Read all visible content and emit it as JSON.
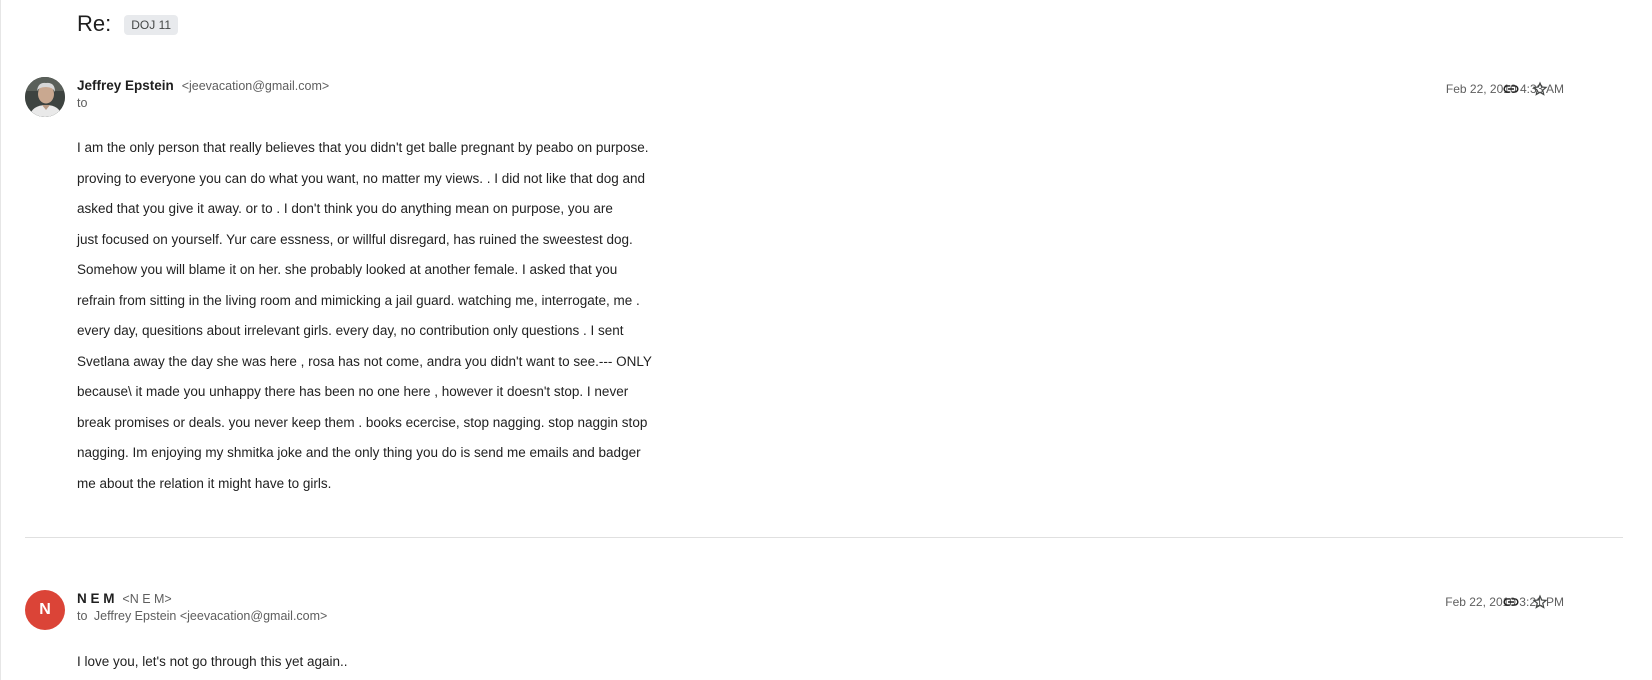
{
  "thread": {
    "subject": "Re:",
    "label": "DOJ 11"
  },
  "messages": [
    {
      "sender_name": "Jeffrey Epstein",
      "sender_email": "<jeevacation@gmail.com>",
      "to_word": "to",
      "recipient": "",
      "date": "Feb 22, 2010 4:33 AM",
      "avatar": "profile-photo",
      "body_lines": [
        "I am the only person that really believes that you didn't get balle pregnant by peabo on purpose.",
        "proving to everyone you can do what you want, no matter my views. . I did not like that dog and",
        "asked that you give it away. or to . I don't think you do anything mean on purpose, you are",
        "just focused on yourself. Yur care essness, or willful disregard, has ruined the sweestest dog.",
        "Somehow you will blame it on her. she probably looked at another female. I asked that you",
        "refrain from sitting in the living room and mimicking a jail guard. watching me, interrogate, me .",
        "every day, quesitions about irrelevant girls. every day, no contribution only questions . I sent",
        "Svetlana away the day she was here , rosa has not come, andra you didn't want to see.--- ONLY",
        "because\\ it made you unhappy there has been no one here , however it doesn't stop. I never",
        "break promises or deals. you never keep them . books ecercise, stop nagging. stop naggin stop",
        "nagging. Im enjoying my shmitka joke and the only thing you do is send me emails and badger",
        "me about the relation it might have to girls."
      ]
    },
    {
      "sender_name": "N E M",
      "sender_email": "<N E M>",
      "avatar_letter": "N",
      "to_word": "to",
      "recipient": "Jeffrey Epstein <jeevacation@gmail.com>",
      "date": "Feb 22, 2010 3:21 PM",
      "body_lines": [
        "I love you, let's not go through this yet again.."
      ]
    }
  ],
  "icons": {
    "link": "link-icon",
    "star": "star-outline-icon"
  },
  "colors": {
    "avatar_letter_bg": "#db4437",
    "label_chip_bg": "#e8eaed",
    "divider": "#e0e0e0"
  }
}
